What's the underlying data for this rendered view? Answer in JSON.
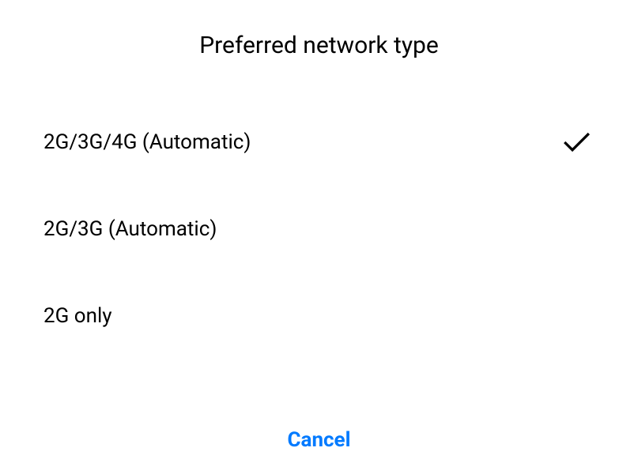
{
  "dialog": {
    "title": "Preferred network type",
    "cancel_label": "Cancel"
  },
  "options": [
    {
      "label": "2G/3G/4G (Automatic)",
      "selected": true
    },
    {
      "label": "2G/3G (Automatic)",
      "selected": false
    },
    {
      "label": "2G only",
      "selected": false
    }
  ]
}
